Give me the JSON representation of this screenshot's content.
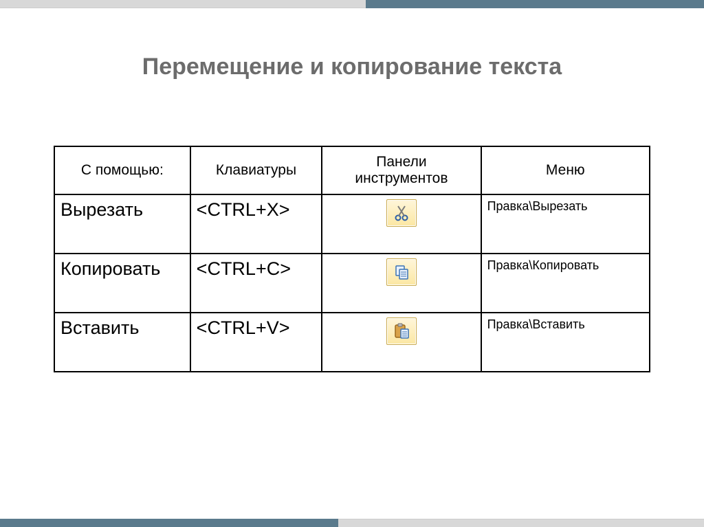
{
  "title": "Перемещение и копирование текста",
  "headers": {
    "with_help": "С помощью:",
    "keyboard": "Клавиатуры",
    "toolbar": "Панели инструментов",
    "menu": "Меню"
  },
  "rows": [
    {
      "action": "Вырезать",
      "shortcut": "<CTRL+X>",
      "icon": "cut",
      "menu_path": "Правка\\Вырезать"
    },
    {
      "action": "Копировать",
      "shortcut": "<CTRL+C>",
      "icon": "copy",
      "menu_path": "Правка\\Копировать"
    },
    {
      "action": "Вставить",
      "shortcut": "<CTRL+V>",
      "icon": "paste",
      "menu_path": "Правка\\Вставить"
    }
  ]
}
